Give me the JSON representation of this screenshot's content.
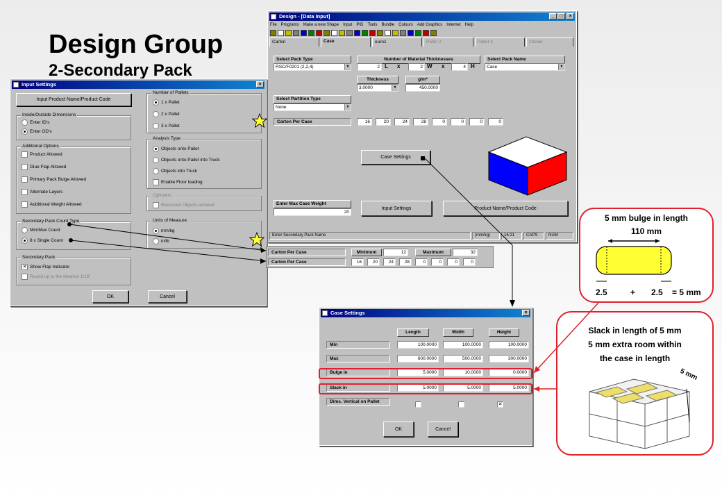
{
  "slide": {
    "title": "Design Group",
    "subtitle": "2-Secondary Pack"
  },
  "design_window": {
    "title": "Design - [Data Input]",
    "menu": [
      "File",
      "Programs",
      "Make a new Shape",
      "Input",
      "PID",
      "Tools",
      "Bundle",
      "Colours",
      "Add Graphics",
      "Internet",
      "Help"
    ],
    "tabs": [
      "Carton",
      "Case",
      "euro1",
      "Pallet 2",
      "Pallet 3",
      "20stan"
    ],
    "select_pack_type": {
      "label": "Select Pack Type",
      "value": "RSC/F0201 (2,2,4)"
    },
    "material_thicknesses": {
      "label": "Number of Material Thicknesses",
      "l": "2",
      "l_unit": "L",
      "w": "2",
      "w_unit": "W",
      "h": "4",
      "h_unit": "H",
      "x1": "x",
      "x2": "x"
    },
    "select_pack_name": {
      "label": "Select Pack Name",
      "value": "Case"
    },
    "thickness": {
      "label": "Thickness",
      "value": "3.0000"
    },
    "gsm": {
      "label": "g/m²",
      "value": "450.0000"
    },
    "select_partition": {
      "label": "Select Partition Type",
      "value": "None"
    },
    "carton_per_case": {
      "label": "Carton Per Case",
      "values": [
        "16",
        "20",
        "24",
        "28",
        "0",
        "0",
        "0",
        "0"
      ]
    },
    "case_settings_button": "Case Settings",
    "max_weight": {
      "label": "Enter Max Case Weight",
      "value": "20"
    },
    "input_settings_button": "Input Settings",
    "product_name_button": "Product Name/Product Code",
    "status": [
      "Enter Secondary Pack Name",
      "(mm/kg)",
      "16:21",
      "CAPS",
      "NUM"
    ]
  },
  "input_settings": {
    "title": "Input Settings",
    "product_button": "Input Product Name/Product Code",
    "dims_group": "Inside/Outside Dimensions",
    "dims_options": [
      {
        "label": "Enter ID's",
        "on": false
      },
      {
        "label": "Enter OD's",
        "on": true
      }
    ],
    "additional_group": "Additional Options",
    "additional_options": [
      "Product Allowed",
      "Glue Flap Allowed",
      "Primary Pack Bulge Allowed",
      "Alternate Layers",
      "Additional Weight Allowed"
    ],
    "count_group": "Secondary Pack Count Type",
    "count_options": [
      {
        "label": "Min/Max Count",
        "on": false
      },
      {
        "label": "8 x Single Count",
        "on": true
      }
    ],
    "secondary_group": "Secondary Pack",
    "secondary_options": [
      {
        "label": "Show Flap Indicator",
        "checked": true,
        "dim": false
      },
      {
        "label": "Round up to the Nearest 1/16\"",
        "checked": false,
        "dim": true
      }
    ],
    "pallets_group": "Number of Pallets",
    "pallet_options": [
      {
        "label": "1 x Pallet",
        "on": true
      },
      {
        "label": "2 x Pallet",
        "on": false
      },
      {
        "label": "3 x Pallet",
        "on": false
      }
    ],
    "analysis_group": "Analysis Type",
    "analysis_options": [
      {
        "label": "Objects onto Pallet",
        "on": true
      },
      {
        "label": "Objects onto Pallet into Truck",
        "on": false
      },
      {
        "label": "Objects into Truck",
        "on": false
      }
    ],
    "floor_loading": "Enable Floor loading",
    "cylinders_group": "Cylinders",
    "recessed": "Recessed Objects allowed",
    "units_group": "Units of Measure",
    "unit_options": [
      {
        "label": "mm/kg",
        "on": true
      },
      {
        "label": "in/lb",
        "on": false
      }
    ],
    "ok": "OK",
    "cancel": "Cancel"
  },
  "count_strip": {
    "row1_label": "Carton Per Case",
    "minimum_label": "Minimum",
    "minimum": "12",
    "maximum_label": "Maximum",
    "maximum": "32",
    "row2_label": "Carton Per Case",
    "values": [
      "16",
      "20",
      "24",
      "28",
      "0",
      "0",
      "0",
      "0"
    ]
  },
  "case_settings": {
    "title": "Case Settings",
    "columns": [
      "Length",
      "Width",
      "Height"
    ],
    "rows": [
      {
        "label": "Min",
        "values": [
          "100.0000",
          "100.0000",
          "100.0000"
        ]
      },
      {
        "label": "Max",
        "values": [
          "600.0000",
          "500.0000",
          "300.0000"
        ]
      },
      {
        "label": "Bulge in",
        "values": [
          "5.0000",
          "10.0000",
          "0.0000"
        ]
      },
      {
        "label": "Slack in",
        "values": [
          "5.0000",
          "5.0000",
          "5.0000"
        ]
      }
    ],
    "dims_vertical": "Dims. Vertical on Pallet",
    "dims_checked": [
      false,
      false,
      true
    ],
    "ok": "OK",
    "cancel": "Cancel"
  },
  "bulge_callout": {
    "title": "5 mm bulge in length",
    "length": "110 mm",
    "left": "2.5",
    "plus": "+",
    "right": "2.5",
    "result": "= 5 mm"
  },
  "slack_callout": {
    "line1": "Slack in length of 5 mm",
    "line2": "5 mm extra room within",
    "line3": "the case in length",
    "dim": "5 mm"
  },
  "colors": {
    "accent_red": "#e0202a",
    "title_bar": "#000080",
    "bulge_fill": "#ffff33"
  }
}
